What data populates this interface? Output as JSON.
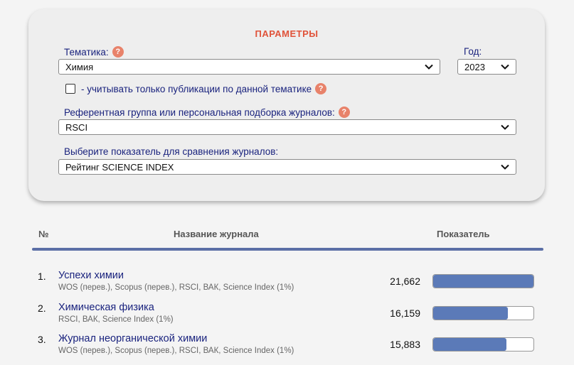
{
  "panel": {
    "title": "ПАРАМЕТРЫ",
    "topic_label": "Тематика:",
    "topic_value": "Химия",
    "year_label": "Год:",
    "year_value": "2023",
    "checkbox_label": "- учитывать только публикации по данной тематике",
    "checkbox_checked": false,
    "group_label": "Референтная группа или персональная подборка журналов:",
    "group_value": "RSCI",
    "indicator_label": "Выберите показатель для сравнения журналов:",
    "indicator_value": "Рейтинг SCIENCE INDEX",
    "help_symbol": "?"
  },
  "table": {
    "col_num": "№",
    "col_title": "Название журнала",
    "col_value": "Показатель",
    "rows": [
      {
        "num": "1.",
        "title": "Успехи химии",
        "sub": "WOS (перев.), Scopus (перев.), RSCI, ВАК, Science Index (1%)",
        "value": "21,662",
        "fraction": 1.0
      },
      {
        "num": "2.",
        "title": "Химическая физика",
        "sub": "RSCI, ВАК, Science Index (1%)",
        "value": "16,159",
        "fraction": 0.746
      },
      {
        "num": "3.",
        "title": "Журнал неорганической химии",
        "sub": "WOS (перев.), Scopus (перев.), RSCI, ВАК, Science Index (1%)",
        "value": "15,883",
        "fraction": 0.733
      }
    ]
  },
  "colors": {
    "accent": "#e0533a",
    "bar": "#5b7ab8",
    "divider": "#5b6fa6",
    "link": "#1a237e"
  }
}
